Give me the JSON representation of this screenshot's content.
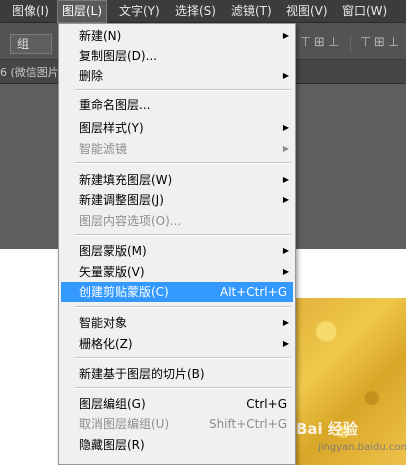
{
  "menubar": {
    "items": [
      {
        "label": "图像(I)"
      },
      {
        "label": "图层(L)"
      },
      {
        "label": "文字(Y)"
      },
      {
        "label": "选择(S)"
      },
      {
        "label": "滤镜(T)"
      },
      {
        "label": "视图(V)"
      },
      {
        "label": "窗口(W)"
      }
    ]
  },
  "options": {
    "group_label": "组"
  },
  "doc_tab": {
    "label": "6 (微信图片"
  },
  "layer_menu": {
    "items": [
      {
        "label": "新建(N)",
        "submenu": true
      },
      {
        "label": "复制图层(D)..."
      },
      {
        "label": "删除",
        "submenu": true
      },
      {
        "label": "重命名图层..."
      },
      {
        "label": "图层样式(Y)",
        "submenu": true
      },
      {
        "label": "智能滤镜",
        "submenu": true,
        "disabled": true
      },
      {
        "label": "新建填充图层(W)",
        "submenu": true
      },
      {
        "label": "新建调整图层(J)",
        "submenu": true
      },
      {
        "label": "图层内容选项(O)...",
        "disabled": true
      },
      {
        "label": "图层蒙版(M)",
        "submenu": true
      },
      {
        "label": "矢量蒙版(V)",
        "submenu": true
      },
      {
        "label": "创建剪贴蒙版(C)",
        "shortcut": "Alt+Ctrl+G",
        "highlighted": true
      },
      {
        "label": "智能对象",
        "submenu": true
      },
      {
        "label": "栅格化(Z)",
        "submenu": true
      },
      {
        "label": "新建基于图层的切片(B)"
      },
      {
        "label": "图层编组(G)",
        "shortcut": "Ctrl+G"
      },
      {
        "label": "取消图层编组(U)",
        "shortcut": "Shift+Ctrl+G",
        "disabled": true
      },
      {
        "label": "隐藏图层(R)"
      }
    ]
  },
  "watermark": {
    "text": "Bai 经验",
    "sub": "jingyan.baidu.com"
  },
  "colors": {
    "menubar_bg": "#3c3c3c",
    "menu_bg": "#f0f0f0",
    "highlight": "#3399ff",
    "disabled_text": "#8d8d8d"
  }
}
